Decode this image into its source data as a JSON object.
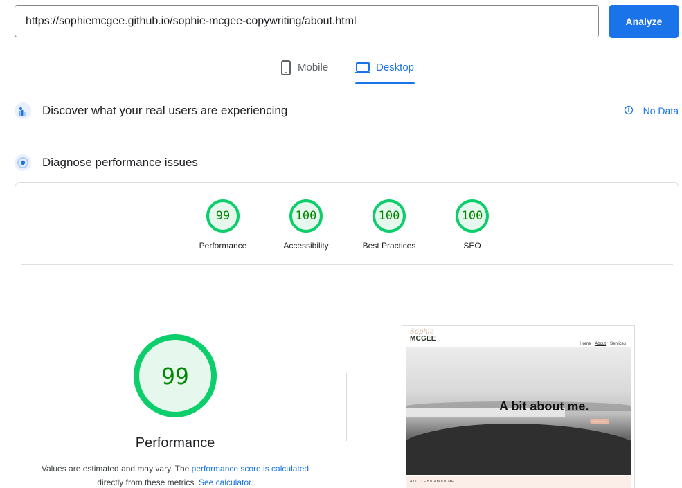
{
  "search": {
    "url": "https://sophiemcgee.github.io/sophie-mcgee-copywriting/about.html",
    "analyze_label": "Analyze"
  },
  "device_tabs": [
    {
      "label": "Mobile",
      "icon": "phone-icon",
      "selected": false
    },
    {
      "label": "Desktop",
      "icon": "laptop-icon",
      "selected": true
    }
  ],
  "crux": {
    "title": "Discover what your real users are experiencing",
    "status": "No Data",
    "icon": "users-chart-icon"
  },
  "diagnose": {
    "title": "Diagnose performance issues",
    "icon": "lighthouse-icon"
  },
  "scores": [
    {
      "label": "Performance",
      "value": "99"
    },
    {
      "label": "Accessibility",
      "value": "100"
    },
    {
      "label": "Best Practices",
      "value": "100"
    },
    {
      "label": "SEO",
      "value": "100"
    }
  ],
  "performance": {
    "score": "99",
    "title": "Performance",
    "note_prefix": "Values are estimated and may vary. The ",
    "note_link1": "performance score is calculated",
    "note_middle": " directly from these metrics. ",
    "note_link2": "See calculator",
    "note_suffix": "."
  },
  "preview": {
    "logo_script": "Sophie",
    "logo_text": "MCGEE",
    "nav": [
      "Home",
      "About",
      "Services"
    ],
    "active_nav": "About",
    "hero_title": "A bit about me.",
    "hero_button": "Find out more",
    "subhead": "A LITTLE BIT ABOUT ME"
  },
  "colors": {
    "accent": "#1a73e8",
    "pass": "#0cce6b",
    "pass_text": "#008800",
    "pass_fill": "#e6f8ee"
  }
}
